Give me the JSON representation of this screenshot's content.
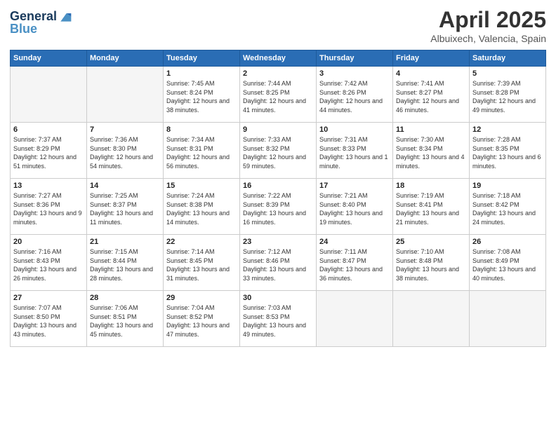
{
  "header": {
    "logo_line1": "General",
    "logo_line2": "Blue",
    "month": "April 2025",
    "location": "Albuixech, Valencia, Spain"
  },
  "weekdays": [
    "Sunday",
    "Monday",
    "Tuesday",
    "Wednesday",
    "Thursday",
    "Friday",
    "Saturday"
  ],
  "weeks": [
    [
      {
        "day": "",
        "info": ""
      },
      {
        "day": "",
        "info": ""
      },
      {
        "day": "1",
        "info": "Sunrise: 7:45 AM\nSunset: 8:24 PM\nDaylight: 12 hours and 38 minutes."
      },
      {
        "day": "2",
        "info": "Sunrise: 7:44 AM\nSunset: 8:25 PM\nDaylight: 12 hours and 41 minutes."
      },
      {
        "day": "3",
        "info": "Sunrise: 7:42 AM\nSunset: 8:26 PM\nDaylight: 12 hours and 44 minutes."
      },
      {
        "day": "4",
        "info": "Sunrise: 7:41 AM\nSunset: 8:27 PM\nDaylight: 12 hours and 46 minutes."
      },
      {
        "day": "5",
        "info": "Sunrise: 7:39 AM\nSunset: 8:28 PM\nDaylight: 12 hours and 49 minutes."
      }
    ],
    [
      {
        "day": "6",
        "info": "Sunrise: 7:37 AM\nSunset: 8:29 PM\nDaylight: 12 hours and 51 minutes."
      },
      {
        "day": "7",
        "info": "Sunrise: 7:36 AM\nSunset: 8:30 PM\nDaylight: 12 hours and 54 minutes."
      },
      {
        "day": "8",
        "info": "Sunrise: 7:34 AM\nSunset: 8:31 PM\nDaylight: 12 hours and 56 minutes."
      },
      {
        "day": "9",
        "info": "Sunrise: 7:33 AM\nSunset: 8:32 PM\nDaylight: 12 hours and 59 minutes."
      },
      {
        "day": "10",
        "info": "Sunrise: 7:31 AM\nSunset: 8:33 PM\nDaylight: 13 hours and 1 minute."
      },
      {
        "day": "11",
        "info": "Sunrise: 7:30 AM\nSunset: 8:34 PM\nDaylight: 13 hours and 4 minutes."
      },
      {
        "day": "12",
        "info": "Sunrise: 7:28 AM\nSunset: 8:35 PM\nDaylight: 13 hours and 6 minutes."
      }
    ],
    [
      {
        "day": "13",
        "info": "Sunrise: 7:27 AM\nSunset: 8:36 PM\nDaylight: 13 hours and 9 minutes."
      },
      {
        "day": "14",
        "info": "Sunrise: 7:25 AM\nSunset: 8:37 PM\nDaylight: 13 hours and 11 minutes."
      },
      {
        "day": "15",
        "info": "Sunrise: 7:24 AM\nSunset: 8:38 PM\nDaylight: 13 hours and 14 minutes."
      },
      {
        "day": "16",
        "info": "Sunrise: 7:22 AM\nSunset: 8:39 PM\nDaylight: 13 hours and 16 minutes."
      },
      {
        "day": "17",
        "info": "Sunrise: 7:21 AM\nSunset: 8:40 PM\nDaylight: 13 hours and 19 minutes."
      },
      {
        "day": "18",
        "info": "Sunrise: 7:19 AM\nSunset: 8:41 PM\nDaylight: 13 hours and 21 minutes."
      },
      {
        "day": "19",
        "info": "Sunrise: 7:18 AM\nSunset: 8:42 PM\nDaylight: 13 hours and 24 minutes."
      }
    ],
    [
      {
        "day": "20",
        "info": "Sunrise: 7:16 AM\nSunset: 8:43 PM\nDaylight: 13 hours and 26 minutes."
      },
      {
        "day": "21",
        "info": "Sunrise: 7:15 AM\nSunset: 8:44 PM\nDaylight: 13 hours and 28 minutes."
      },
      {
        "day": "22",
        "info": "Sunrise: 7:14 AM\nSunset: 8:45 PM\nDaylight: 13 hours and 31 minutes."
      },
      {
        "day": "23",
        "info": "Sunrise: 7:12 AM\nSunset: 8:46 PM\nDaylight: 13 hours and 33 minutes."
      },
      {
        "day": "24",
        "info": "Sunrise: 7:11 AM\nSunset: 8:47 PM\nDaylight: 13 hours and 36 minutes."
      },
      {
        "day": "25",
        "info": "Sunrise: 7:10 AM\nSunset: 8:48 PM\nDaylight: 13 hours and 38 minutes."
      },
      {
        "day": "26",
        "info": "Sunrise: 7:08 AM\nSunset: 8:49 PM\nDaylight: 13 hours and 40 minutes."
      }
    ],
    [
      {
        "day": "27",
        "info": "Sunrise: 7:07 AM\nSunset: 8:50 PM\nDaylight: 13 hours and 43 minutes."
      },
      {
        "day": "28",
        "info": "Sunrise: 7:06 AM\nSunset: 8:51 PM\nDaylight: 13 hours and 45 minutes."
      },
      {
        "day": "29",
        "info": "Sunrise: 7:04 AM\nSunset: 8:52 PM\nDaylight: 13 hours and 47 minutes."
      },
      {
        "day": "30",
        "info": "Sunrise: 7:03 AM\nSunset: 8:53 PM\nDaylight: 13 hours and 49 minutes."
      },
      {
        "day": "",
        "info": ""
      },
      {
        "day": "",
        "info": ""
      },
      {
        "day": "",
        "info": ""
      }
    ]
  ]
}
